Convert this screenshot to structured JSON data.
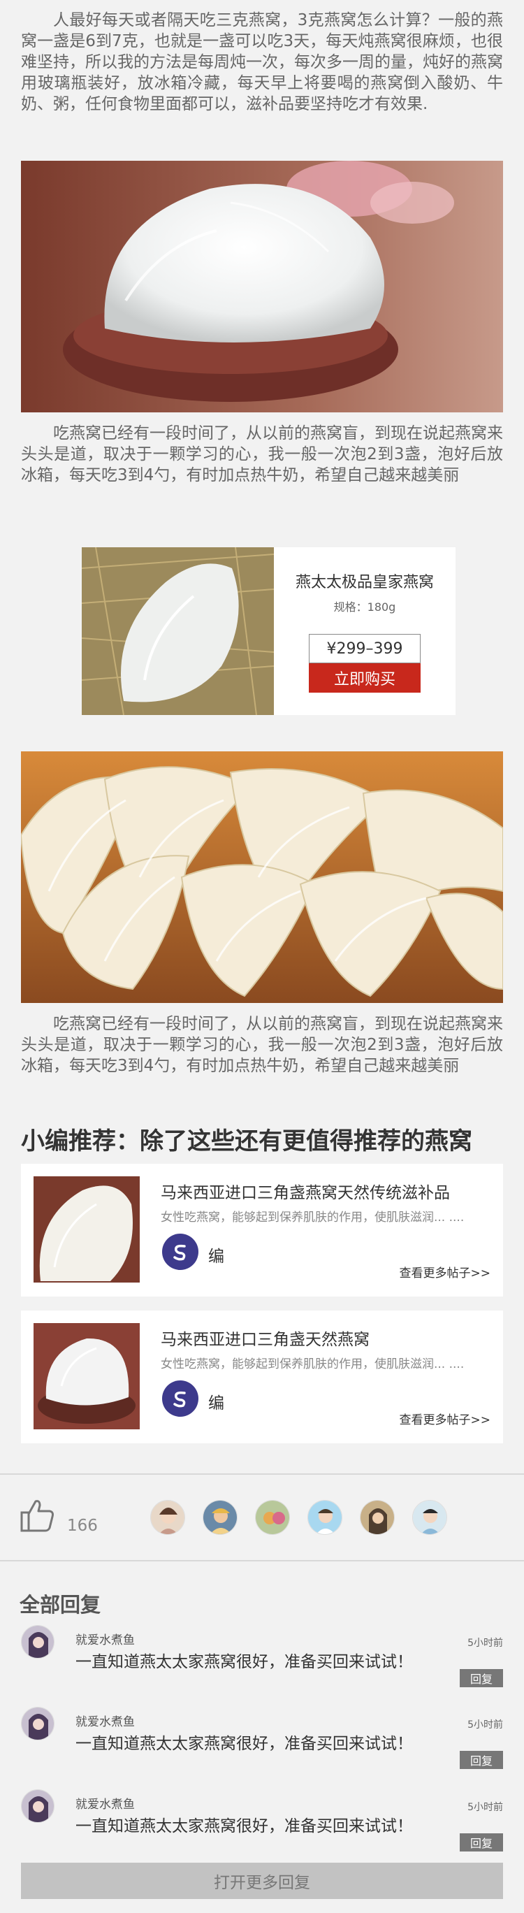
{
  "article": {
    "para1": "人最好每天或者隔天吃三克燕窝，3克燕窝怎么计算？一般的燕窝一盏是6到7克，也就是一盏可以吃3天，每天炖燕窝很麻烦，也很难坚持，所以我的方法是每周炖一次，每次多一周的量，炖好的燕窝用玻璃瓶装好，放冰箱冷藏，每天早上将要喝的燕窝倒入酸奶、牛奶、粥，任何食物里面都可以，滋补品要坚持吃才有效果.",
    "para2": "吃燕窝已经有一段时间了，从以前的燕窝盲，到现在说起燕窝来头头是道，取决于一颗学习的心，我一般一次泡2到3盏，泡好后放冰箱，每天吃3到4勺，有时加点热牛奶，希望自己越来越美丽",
    "para3": "吃燕窝已经有一段时间了，从以前的燕窝盲，到现在说起燕窝来头头是道，取决于一颗学习的心，我一般一次泡2到3盏，泡好后放冰箱，每天吃3到4勺，有时加点热牛奶，希望自己越来越美丽"
  },
  "product": {
    "title": "燕太太极品皇家燕窝",
    "spec": "规格：180g",
    "price": "¥299–399",
    "buy_label": "立即购买"
  },
  "recommend": {
    "title": "小编推荐：除了这些还有更值得推荐的燕窝",
    "items": [
      {
        "title": "马来西亚进口三角盏燕窝天然传统滋补品",
        "desc": "女性吃燕窝，能够起到保养肌肤的作用，使肌肤滋润... ....",
        "author": "编",
        "more": "查看更多帖子>>"
      },
      {
        "title": "马来西亚进口三角盏天然燕窝",
        "desc": "女性吃燕窝，能够起到保养肌肤的作用，使肌肤滋润... ....",
        "author": "编",
        "more": "查看更多帖子>>"
      }
    ]
  },
  "likes": {
    "count": "166"
  },
  "replies": {
    "title": "全部回复",
    "items": [
      {
        "name": "就爱水煮鱼",
        "text": "一直知道燕太太家燕窝很好，准备买回来试试！",
        "time": "5小时前",
        "reply_label": "回复"
      },
      {
        "name": "就爱水煮鱼",
        "text": "一直知道燕太太家燕窝很好，准备买回来试试！",
        "time": "5小时前",
        "reply_label": "回复"
      },
      {
        "name": "就爱水煮鱼",
        "text": "一直知道燕太太家燕窝很好，准备买回来试试！",
        "time": "5小时前",
        "reply_label": "回复"
      }
    ],
    "load_more": "打开更多回复"
  },
  "colors": {
    "buy_button": "#c8281c",
    "author_avatar": "#3d3a8c",
    "reply_button": "#777777"
  },
  "icons": [
    "like-icon",
    "author-logo-icon"
  ]
}
